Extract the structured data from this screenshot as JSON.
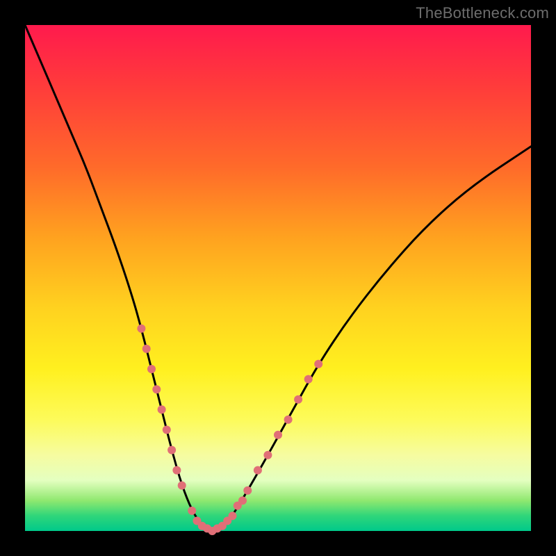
{
  "watermark": "TheBottleneck.com",
  "colors": {
    "frame": "#000000",
    "curve_stroke": "#000000",
    "marker_fill": "#e06f77",
    "gradient_top": "#ff1a4d",
    "gradient_bottom": "#00c98a"
  },
  "chart_data": {
    "type": "line",
    "title": "",
    "xlabel": "",
    "ylabel": "",
    "xlim": [
      0,
      100
    ],
    "ylim": [
      0,
      100
    ],
    "grid": false,
    "legend": false,
    "x": [
      0,
      3,
      6,
      9,
      12,
      15,
      18,
      21,
      23,
      25,
      27,
      29,
      31,
      33,
      35,
      37,
      39,
      41,
      44,
      48,
      53,
      58,
      64,
      71,
      79,
      88,
      100
    ],
    "values": [
      100,
      93,
      86,
      79,
      72,
      64,
      56,
      47,
      40,
      32,
      24,
      16,
      9,
      4,
      1,
      0,
      1,
      3,
      8,
      15,
      24,
      33,
      42,
      51,
      60,
      68,
      76
    ],
    "curve_note": "V-shaped curve; y taken as approximate % of plot height from bottom, x as % of plot width from left",
    "markers": {
      "description": "short pink dotted segments near the trough on both branches",
      "points": [
        {
          "x": 23,
          "y": 40
        },
        {
          "x": 24,
          "y": 36
        },
        {
          "x": 25,
          "y": 32
        },
        {
          "x": 26,
          "y": 28
        },
        {
          "x": 27,
          "y": 24
        },
        {
          "x": 28,
          "y": 20
        },
        {
          "x": 29,
          "y": 16
        },
        {
          "x": 30,
          "y": 12
        },
        {
          "x": 31,
          "y": 9
        },
        {
          "x": 33,
          "y": 4
        },
        {
          "x": 34,
          "y": 2
        },
        {
          "x": 35,
          "y": 1
        },
        {
          "x": 36,
          "y": 0.5
        },
        {
          "x": 37,
          "y": 0
        },
        {
          "x": 38,
          "y": 0.5
        },
        {
          "x": 39,
          "y": 1
        },
        {
          "x": 40,
          "y": 2
        },
        {
          "x": 41,
          "y": 3
        },
        {
          "x": 42,
          "y": 5
        },
        {
          "x": 43,
          "y": 6
        },
        {
          "x": 44,
          "y": 8
        },
        {
          "x": 46,
          "y": 12
        },
        {
          "x": 48,
          "y": 15
        },
        {
          "x": 50,
          "y": 19
        },
        {
          "x": 52,
          "y": 22
        },
        {
          "x": 54,
          "y": 26
        },
        {
          "x": 56,
          "y": 30
        },
        {
          "x": 58,
          "y": 33
        }
      ]
    }
  }
}
